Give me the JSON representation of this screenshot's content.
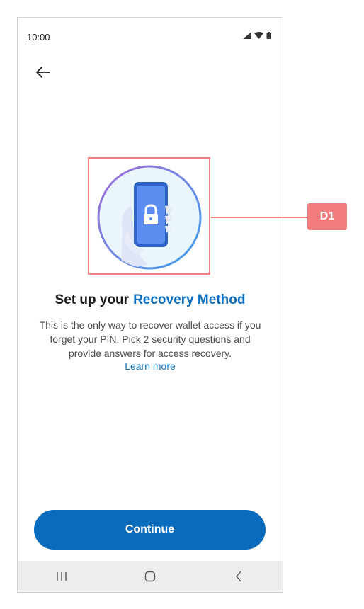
{
  "status_bar": {
    "time": "10:00",
    "icons": [
      "signal-icon",
      "wifi-icon",
      "battery-icon"
    ]
  },
  "header": {
    "back_icon": "arrow-left-icon"
  },
  "illustration": {
    "icon": "phone-lock-icon",
    "colors": {
      "circle_fill": "#eaf5fc",
      "ring_start": "#a56bd6",
      "ring_end": "#3aa0f0",
      "phone": "#3f7ddf",
      "screen": "#5b8ef0"
    }
  },
  "main": {
    "title_prefix": "Set up your",
    "title_accent": "Recovery Method",
    "description": "This is the only way to recover wallet access if you forget your PIN. Pick 2 security questions and provide answers for access recovery.",
    "learn_more": "Learn more"
  },
  "footer": {
    "continue_label": "Continue"
  },
  "nav_bar": {
    "items": [
      "recents-icon",
      "home-icon",
      "back-icon"
    ]
  },
  "annotation": {
    "badge_label": "D1"
  },
  "colors": {
    "accent": "#0b6fc1",
    "button": "#0a6bbd",
    "annotation": "#f08080"
  }
}
